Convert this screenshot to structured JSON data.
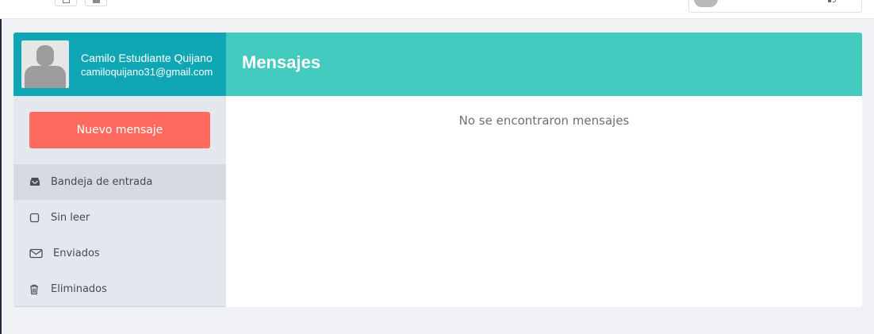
{
  "profile": {
    "name": "Camilo Estudiante Quijano",
    "email": "camiloquijano31@gmail.com"
  },
  "compose": {
    "label": "Nuevo mensaje"
  },
  "nav": [
    {
      "label": "Bandeja de entrada",
      "icon": "inbox-icon",
      "active": true
    },
    {
      "label": "Sin leer",
      "icon": "square-icon",
      "active": false
    },
    {
      "label": "Enviados",
      "icon": "envelope-icon",
      "active": false
    },
    {
      "label": "Eliminados",
      "icon": "trash-icon",
      "active": false
    }
  ],
  "main": {
    "title": "Mensajes",
    "empty_text": "No se encontraron mensajes"
  },
  "colors": {
    "profile_bg": "#0fa7b5",
    "header_bg": "#44cbc0",
    "compose_bg": "#ff6b5f",
    "sidebar_bg": "#e5e7ef",
    "active_item_bg": "#d7d9e1"
  }
}
